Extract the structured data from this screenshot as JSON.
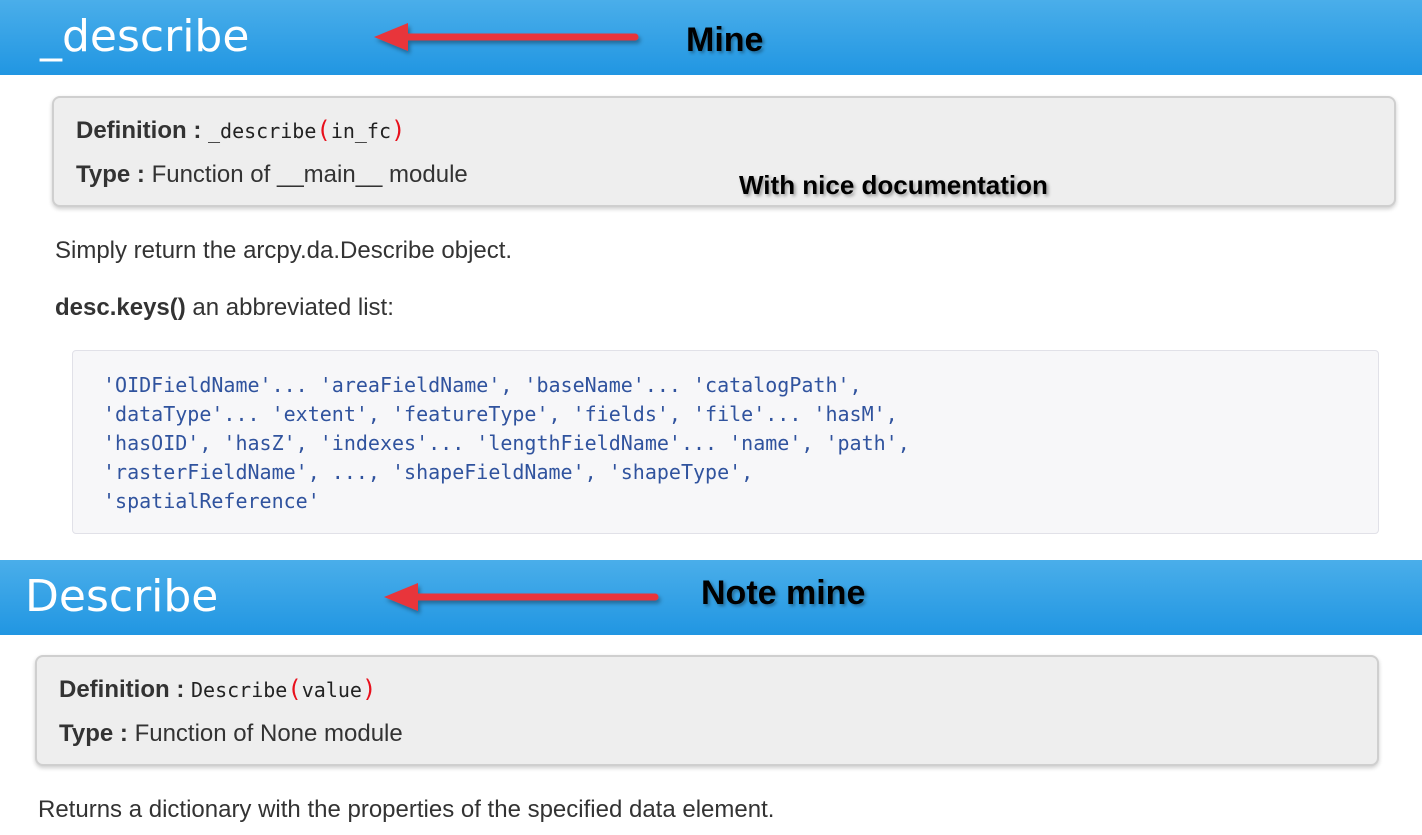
{
  "section1": {
    "title": "_describe",
    "annotation_label": "Mine",
    "doc_note": "With nice documentation",
    "definition_label": "Definition :",
    "definition_name": "_describe",
    "definition_open": "(",
    "definition_params": "in_fc",
    "definition_close": ")",
    "type_label": "Type :",
    "type_value": "Function of __main__ module",
    "description": "Simply return the arcpy.da.Describe object.",
    "keys_label": "desc.keys()",
    "keys_text": " an abbreviated list:",
    "code_lines": [
      "'OIDFieldName'... 'areaFieldName', 'baseName'... 'catalogPath',",
      "'dataType'... 'extent', 'featureType', 'fields', 'file'... 'hasM',",
      "'hasOID', 'hasZ', 'indexes'... 'lengthFieldName'... 'name', 'path',",
      "'rasterFieldName', ..., 'shapeFieldName', 'shapeType',",
      "'spatialReference'"
    ]
  },
  "section2": {
    "title": "Describe",
    "annotation_label": "Note mine",
    "definition_label": "Definition :",
    "definition_name": "Describe",
    "definition_open": "(",
    "definition_params": "value",
    "definition_close": ")",
    "type_label": "Type :",
    "type_value": "Function of None module",
    "description": "Returns a dictionary with the properties of the specified data element."
  },
  "colors": {
    "banner_top": "#4aaeea",
    "banner_bottom": "#2196e2",
    "arrow": "#e8353a",
    "paren": "#e8101c",
    "code_text": "#30539e"
  },
  "icons": [
    "arrow-left-icon"
  ]
}
